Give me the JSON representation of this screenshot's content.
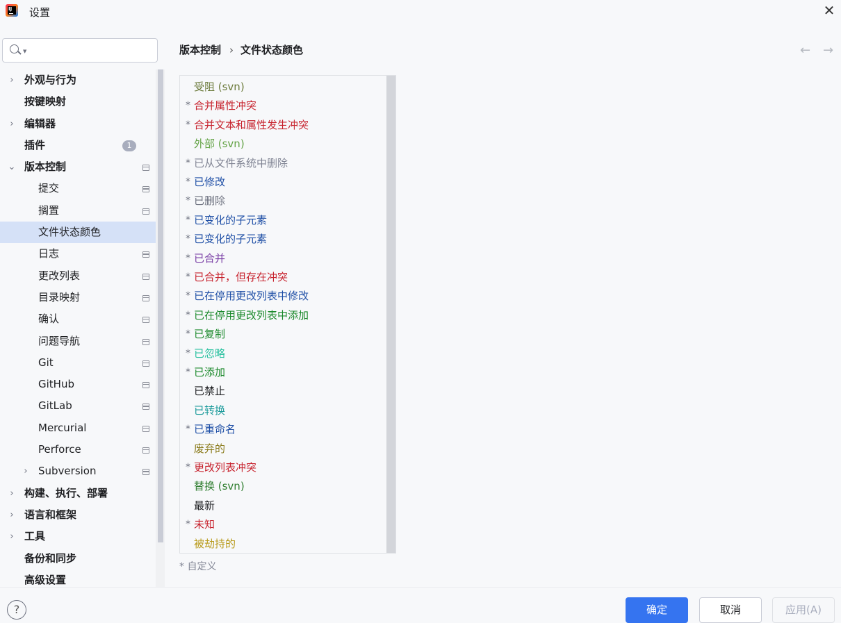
{
  "window": {
    "title": "设置",
    "close_label": "✕"
  },
  "search": {
    "placeholder": ""
  },
  "sidebar": {
    "items": [
      {
        "label": "外观与行为",
        "bold": true,
        "chevron": "›",
        "indent": 0
      },
      {
        "label": "按键映射",
        "bold": true,
        "chevron": "",
        "indent": 0
      },
      {
        "label": "编辑器",
        "bold": true,
        "chevron": "›",
        "indent": 0
      },
      {
        "label": "插件",
        "bold": true,
        "chevron": "",
        "indent": 0,
        "badge": "1"
      },
      {
        "label": "版本控制",
        "bold": true,
        "chevron": "⌄",
        "indent": 0,
        "project": true
      },
      {
        "label": "提交",
        "bold": false,
        "chevron": "",
        "indent": 1,
        "project": true
      },
      {
        "label": "搁置",
        "bold": false,
        "chevron": "",
        "indent": 1,
        "project": true
      },
      {
        "label": "文件状态颜色",
        "bold": false,
        "chevron": "",
        "indent": 1,
        "selected": true
      },
      {
        "label": "日志",
        "bold": false,
        "chevron": "",
        "indent": 1,
        "project": true
      },
      {
        "label": "更改列表",
        "bold": false,
        "chevron": "",
        "indent": 1,
        "project": true
      },
      {
        "label": "目录映射",
        "bold": false,
        "chevron": "",
        "indent": 1,
        "project": true
      },
      {
        "label": "确认",
        "bold": false,
        "chevron": "",
        "indent": 1,
        "project": true
      },
      {
        "label": "问题导航",
        "bold": false,
        "chevron": "",
        "indent": 1,
        "project": true
      },
      {
        "label": "Git",
        "bold": false,
        "chevron": "",
        "indent": 1,
        "project": true
      },
      {
        "label": "GitHub",
        "bold": false,
        "chevron": "",
        "indent": 1,
        "project": true
      },
      {
        "label": "GitLab",
        "bold": false,
        "chevron": "",
        "indent": 1,
        "project": true
      },
      {
        "label": "Mercurial",
        "bold": false,
        "chevron": "",
        "indent": 1,
        "project": true
      },
      {
        "label": "Perforce",
        "bold": false,
        "chevron": "",
        "indent": 1,
        "project": true
      },
      {
        "label": "Subversion",
        "bold": false,
        "chevron": "›",
        "indent": 1,
        "project": true
      },
      {
        "label": "构建、执行、部署",
        "bold": true,
        "chevron": "›",
        "indent": 0
      },
      {
        "label": "语言和框架",
        "bold": true,
        "chevron": "›",
        "indent": 0
      },
      {
        "label": "工具",
        "bold": true,
        "chevron": "›",
        "indent": 0
      },
      {
        "label": "备份和同步",
        "bold": true,
        "chevron": "",
        "indent": 0
      },
      {
        "label": "高级设置",
        "bold": true,
        "chevron": "",
        "indent": 0
      }
    ]
  },
  "breadcrumb": {
    "parent": "版本控制",
    "separator": "›",
    "current": "文件状态颜色"
  },
  "nav": {
    "back": "←",
    "forward": "→"
  },
  "file_status_colors": [
    {
      "label": "受阻 (svn)",
      "custom": false,
      "color": "#6b7a3a"
    },
    {
      "label": "合并属性冲突",
      "custom": true,
      "color": "#c7222d"
    },
    {
      "label": "合并文本和属性发生冲突",
      "custom": true,
      "color": "#c7222d"
    },
    {
      "label": "外部 (svn)",
      "custom": false,
      "color": "#62a244"
    },
    {
      "label": "已从文件系统中删除",
      "custom": true,
      "color": "#818594"
    },
    {
      "label": "已修改",
      "custom": true,
      "color": "#1f4fa6"
    },
    {
      "label": "已删除",
      "custom": true,
      "color": "#6c707e"
    },
    {
      "label": "已变化的子元素",
      "custom": true,
      "color": "#1f4fa6"
    },
    {
      "label": "已变化的子元素",
      "custom": true,
      "color": "#1f4fa6"
    },
    {
      "label": "已合并",
      "custom": true,
      "color": "#7a3fa6"
    },
    {
      "label": "已合并，但存在冲突",
      "custom": true,
      "color": "#c7222d"
    },
    {
      "label": "已在停用更改列表中修改",
      "custom": true,
      "color": "#1f4fa6"
    },
    {
      "label": "已在停用更改列表中添加",
      "custom": true,
      "color": "#1d8a2d"
    },
    {
      "label": "已复制",
      "custom": true,
      "color": "#1d8a2d"
    },
    {
      "label": "已忽略",
      "custom": true,
      "color": "#2ac1a0"
    },
    {
      "label": "已添加",
      "custom": true,
      "color": "#1d8a2d"
    },
    {
      "label": "已禁止",
      "custom": false,
      "color": "#1e1f22"
    },
    {
      "label": "已转换",
      "custom": false,
      "color": "#1a9a9a"
    },
    {
      "label": "已重命名",
      "custom": true,
      "color": "#1f4fa6"
    },
    {
      "label": "废弃的",
      "custom": false,
      "color": "#8a7a1a"
    },
    {
      "label": "更改列表冲突",
      "custom": true,
      "color": "#c7222d"
    },
    {
      "label": "替换 (svn)",
      "custom": false,
      "color": "#2e7d2e"
    },
    {
      "label": "最新",
      "custom": false,
      "color": "#1e1f22"
    },
    {
      "label": "未知",
      "custom": true,
      "color": "#c7222d"
    },
    {
      "label": "被劫持的",
      "custom": false,
      "color": "#b89a1a"
    }
  ],
  "custom_note": "* 自定义",
  "custom_marker": "*",
  "footer": {
    "help": "?",
    "ok_label": "确定",
    "cancel_label": "取消",
    "apply_label": "应用(A)"
  }
}
